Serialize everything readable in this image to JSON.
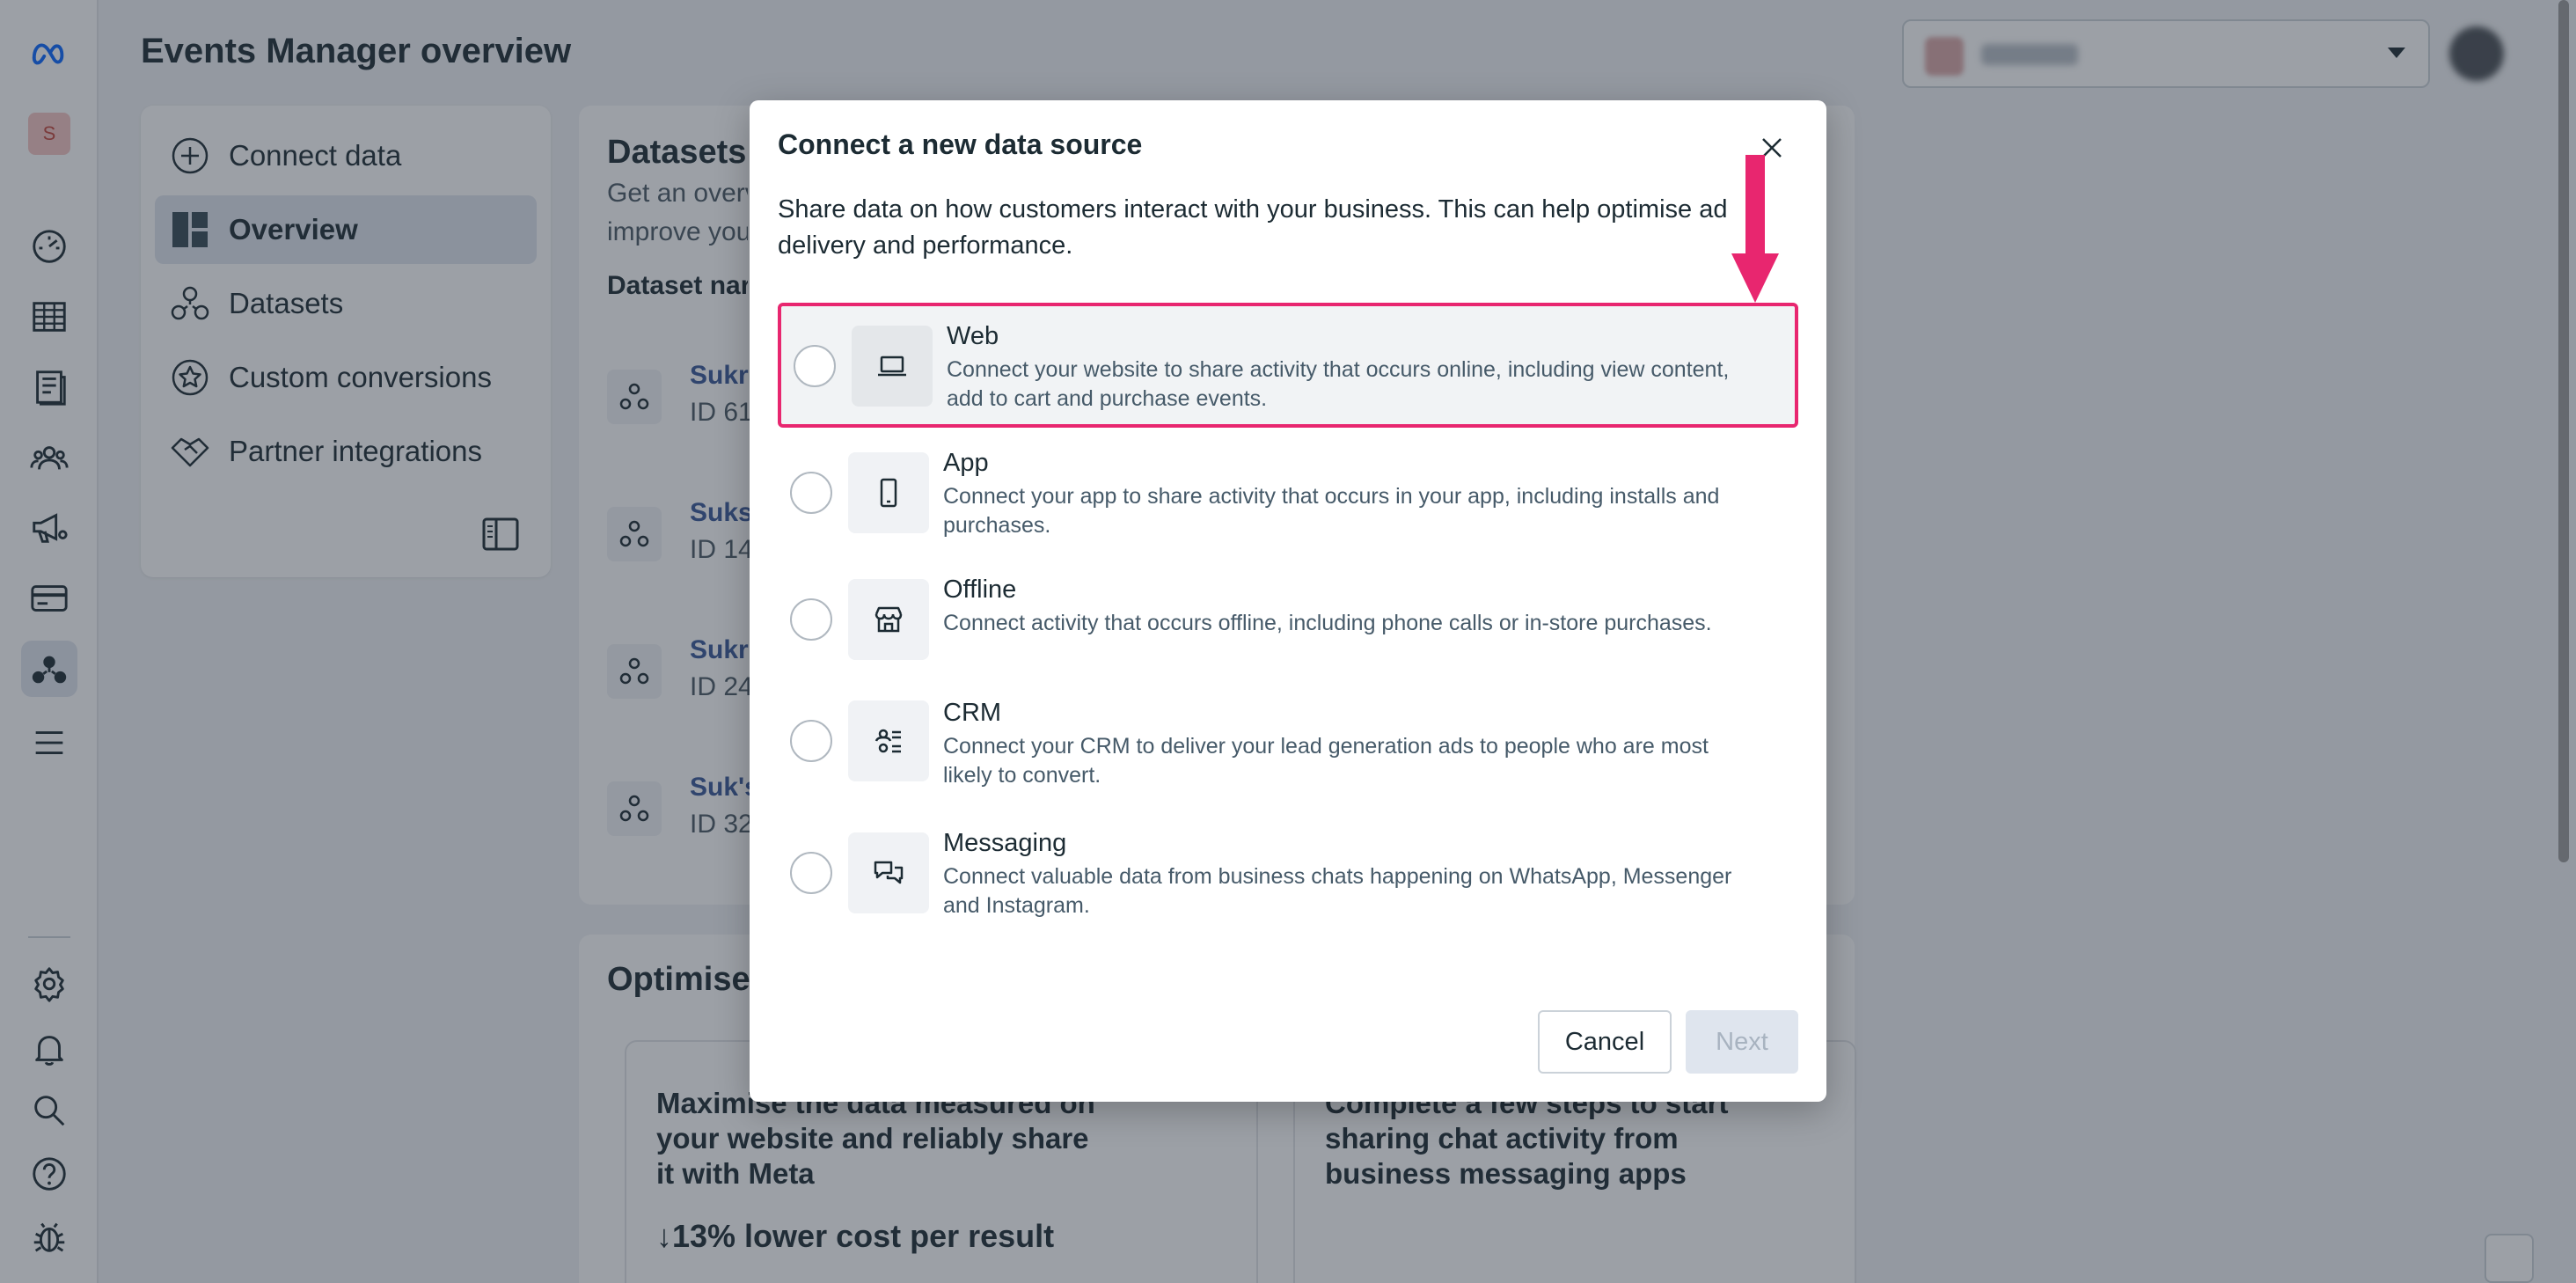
{
  "header": {
    "title": "Events Manager overview"
  },
  "rail": {
    "account_initial": "S",
    "icons": [
      "meta-logo-icon",
      "dashboard-icon",
      "table-icon",
      "pages-icon",
      "audience-icon",
      "campaign-icon",
      "billing-icon",
      "events-manager-icon",
      "menu-icon",
      "settings-icon",
      "notifications-icon",
      "search-icon",
      "help-icon",
      "bug-report-icon"
    ]
  },
  "nav": {
    "items": [
      {
        "label": "Connect data",
        "icon": "plus-circle-icon"
      },
      {
        "label": "Overview",
        "icon": "overview-grid-icon",
        "active": true
      },
      {
        "label": "Datasets",
        "icon": "datasets-icon"
      },
      {
        "label": "Custom conversions",
        "icon": "star-badge-icon"
      },
      {
        "label": "Partner integrations",
        "icon": "handshake-icon"
      }
    ]
  },
  "datasets_card": {
    "title": "Datasets",
    "subtitle_line1": "Get an overv",
    "subtitle_line2": "improve your",
    "column_header": "Dataset nar",
    "rows": [
      {
        "name": "Sukri",
        "id": "ID 61"
      },
      {
        "name": "Suks",
        "id": "ID 14"
      },
      {
        "name": "Sukri",
        "id": "ID 24"
      },
      {
        "name": "Suk's",
        "id": "ID 32"
      }
    ]
  },
  "optimise_card": {
    "title": "Optimise",
    "left_text": "Maximise the data measured on your website and reliably share it with Meta",
    "left_metric": "↓13% lower cost per result",
    "right_text": "Complete a few steps to start sharing chat activity from business messaging apps"
  },
  "modal": {
    "title": "Connect a new data source",
    "description": "Share data on how customers interact with your business. This can help optimise ad delivery and performance.",
    "options": [
      {
        "title": "Web",
        "description": "Connect your website to share activity that occurs online, including view content, add to cart and purchase events.",
        "icon": "laptop-icon",
        "selected": true
      },
      {
        "title": "App",
        "description": "Connect your app to share activity that occurs in your app, including installs and purchases.",
        "icon": "mobile-phone-icon"
      },
      {
        "title": "Offline",
        "description": "Connect activity that occurs offline, including phone calls or in-store purchases.",
        "icon": "store-icon"
      },
      {
        "title": "CRM",
        "description": "Connect your CRM to deliver your lead generation ads to people who are most likely to convert.",
        "icon": "crm-people-icon"
      },
      {
        "title": "Messaging",
        "description": "Connect valuable data from business chats happening on WhatsApp, Messenger and Instagram.",
        "icon": "chat-bubbles-icon"
      }
    ],
    "cancel_label": "Cancel",
    "next_label": "Next"
  },
  "colors": {
    "accent_highlight": "#e8266f",
    "overlay": "rgba(40,48,62,0.46)",
    "link": "#385898"
  }
}
